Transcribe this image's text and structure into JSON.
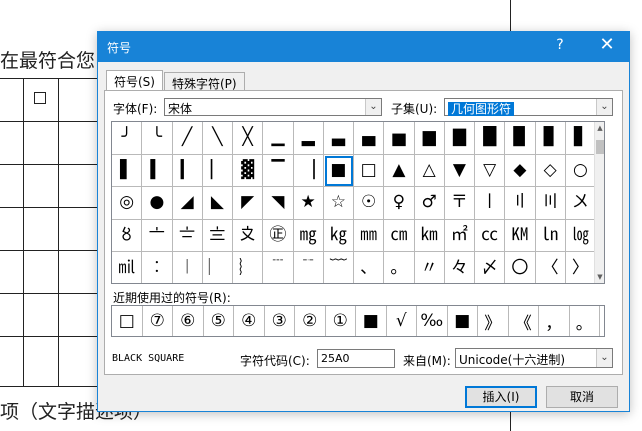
{
  "document": {
    "line1": "在最符合您",
    "line2": "项（文字描述项）"
  },
  "dialog": {
    "title": "符号",
    "help": "?",
    "close": "✕",
    "tabs": [
      "符号(S)",
      "特殊字符(P)"
    ],
    "font_label": "字体(F):",
    "font_value": "宋体",
    "subset_label": "子集(U):",
    "subset_value": "几何图形符",
    "recent_label": "近期使用过的符号(R):",
    "char_name": "BLACK SQUARE",
    "code_label": "字符代码(C):",
    "code_value": "25A0",
    "from_label": "来自(M):",
    "from_value": "Unicode(十六进制)",
    "insert_label": "插入(I)",
    "cancel_label": "取消"
  },
  "symbols": [
    [
      "╯",
      "╰",
      "╱",
      "╲",
      "╳",
      "▁",
      "▂",
      "▃",
      "▄",
      "▅",
      "▆",
      "▇",
      "█",
      "▉",
      "▊",
      "▋"
    ],
    [
      "▌",
      "▍",
      "▎",
      "▏",
      "▓",
      "▔",
      "▕",
      "■",
      "□",
      "▲",
      "△",
      "▼",
      "▽",
      "◆",
      "◇",
      "○"
    ],
    [
      "◎",
      "●",
      "◢",
      "◣",
      "◤",
      "◥",
      "★",
      "☆",
      "☉",
      "♀",
      "♂",
      "〒",
      "〡",
      "〢",
      "〣",
      "〤"
    ],
    [
      "〥",
      "〦",
      "〧",
      "〨",
      "〩",
      "㊣",
      "㎎",
      "㎏",
      "㎜",
      "㎝",
      "㎞",
      "㎡",
      "㏄",
      "㏎",
      "㏑",
      "㏒"
    ],
    [
      "㏕",
      "︰",
      "︱",
      "︳",
      "︴",
      "﹉",
      "﹊",
      "﹋",
      "、",
      "。",
      "〃",
      "々",
      "〆",
      "〇",
      "〈",
      "〉",
      "《",
      "》"
    ]
  ],
  "recent_symbols": [
    "□",
    "⑦",
    "⑥",
    "⑤",
    "④",
    "③",
    "②",
    "①",
    "■",
    "√",
    "‰",
    "■",
    "》",
    "《",
    "，",
    "。"
  ]
}
